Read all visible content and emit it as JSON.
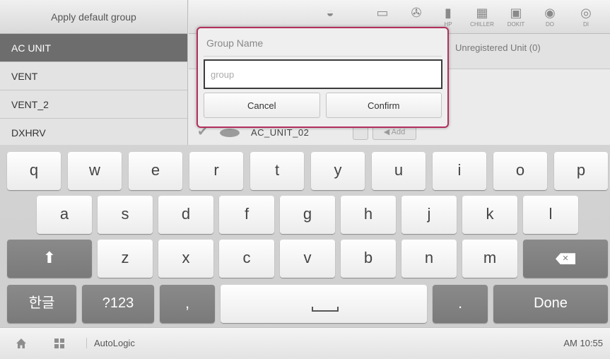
{
  "sidebar": {
    "header": "Apply default group",
    "items": [
      {
        "label": "AC UNIT"
      },
      {
        "label": "VENT"
      },
      {
        "label": "VENT_2"
      },
      {
        "label": "DXHRV"
      }
    ]
  },
  "toolbar": {
    "items": [
      {
        "icon": "ceiling-unit-icon",
        "label": ""
      },
      {
        "icon": "wall-unit-icon",
        "label": ""
      },
      {
        "icon": "fan-unit-icon",
        "label": ""
      },
      {
        "icon": "hp-icon",
        "label": "HP"
      },
      {
        "icon": "chiller-icon",
        "label": "CHILLER"
      },
      {
        "icon": "dokit-icon",
        "label": "DOKIT"
      },
      {
        "icon": "do-icon",
        "label": "DO"
      },
      {
        "icon": "di-icon",
        "label": "DI"
      }
    ]
  },
  "tabs": {
    "unregistered": "Unregistered Unit (0)"
  },
  "unit_row": {
    "name": "AC_UNIT_02",
    "add_label": "Add"
  },
  "dialog": {
    "title": "Group Name",
    "input_placeholder": "group",
    "input_value": "",
    "cancel_label": "Cancel",
    "confirm_label": "Confirm",
    "border_color": "#b3305e"
  },
  "keyboard": {
    "row1": [
      "q",
      "w",
      "e",
      "r",
      "t",
      "y",
      "u",
      "i",
      "o",
      "p"
    ],
    "row2": [
      "a",
      "s",
      "d",
      "f",
      "g",
      "h",
      "j",
      "k",
      "l"
    ],
    "row3": [
      "z",
      "x",
      "c",
      "v",
      "b",
      "n",
      "m"
    ],
    "row4": {
      "lang": "한글",
      "symbols": "?123",
      "comma": ",",
      "period": ".",
      "done": "Done"
    },
    "shift_icon": "shift-icon",
    "backspace_icon": "backspace-icon"
  },
  "statusbar": {
    "app_name": "AutoLogic",
    "time": "AM 10:55"
  }
}
